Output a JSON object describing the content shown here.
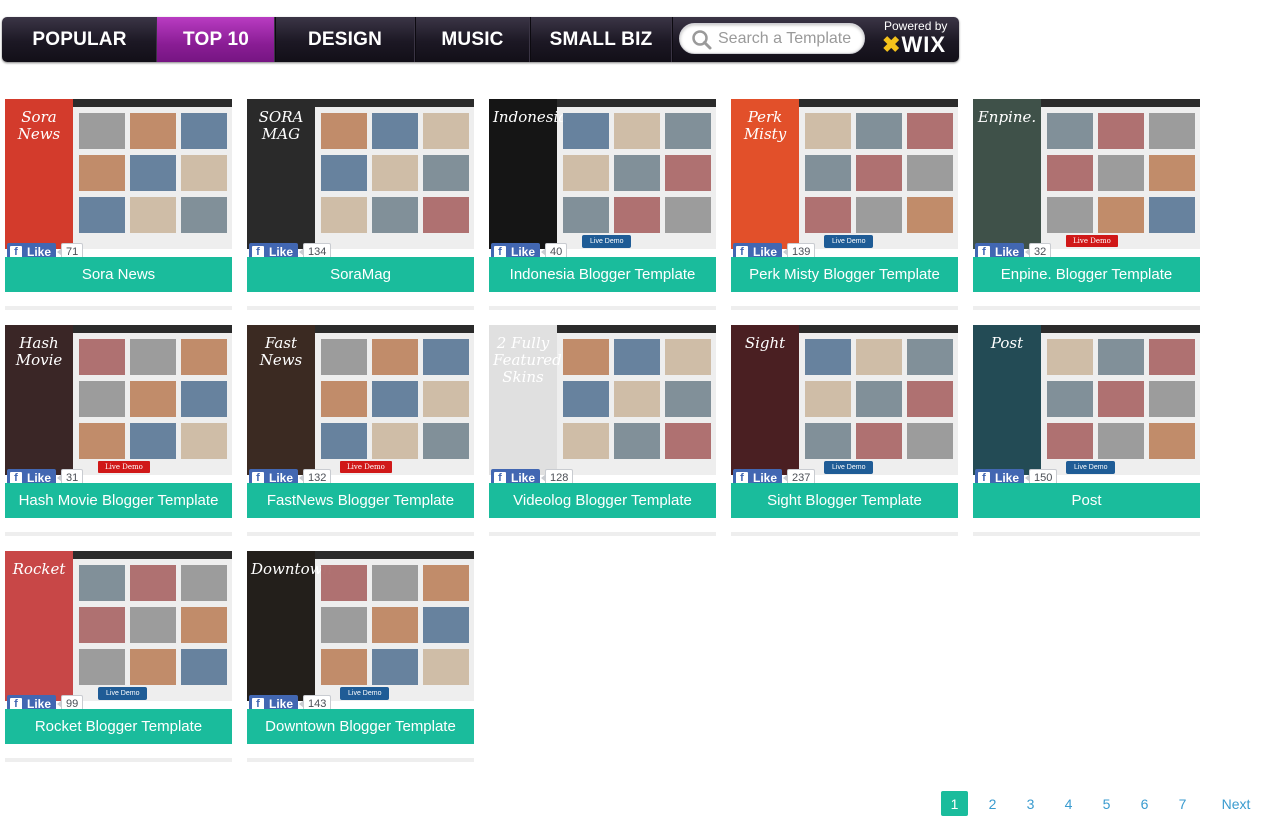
{
  "nav": {
    "tabs": [
      {
        "label": "POPULAR",
        "active": false
      },
      {
        "label": "TOP 10",
        "active": true
      },
      {
        "label": "DESIGN",
        "active": false
      },
      {
        "label": "MUSIC",
        "active": false
      },
      {
        "label": "SMALL BIZ",
        "active": false
      }
    ],
    "search_placeholder": "Search a Template",
    "powered_by": "Powered by",
    "brand": "WIX"
  },
  "colors": {
    "accent": "#1abc9c",
    "active_tab": "#8a1d95",
    "facebook": "#4267b2",
    "link": "#3a9bcf"
  },
  "cards": [
    {
      "title": "Sora News",
      "likes": "71",
      "thumb_label": "Sora News",
      "left_color": "#d33b2c",
      "demo": ""
    },
    {
      "title": "SoraMag",
      "likes": "134",
      "thumb_label": "SORA MAG",
      "left_color": "#2a2a2a",
      "demo": ""
    },
    {
      "title": "Indonesia Blogger Template",
      "likes": "40",
      "thumb_label": "Indonesia",
      "left_color": "#151515",
      "demo": "Live Demo",
      "demo_style": "blue"
    },
    {
      "title": "Perk Misty Blogger Template",
      "likes": "139",
      "thumb_label": "Perk Misty",
      "left_color": "#e2502a",
      "demo": "Live Demo",
      "demo_style": "blue"
    },
    {
      "title": "Enpine. Blogger Template",
      "likes": "32",
      "thumb_label": "Enpine.",
      "left_color": "#3f5149",
      "demo": "Live Demo",
      "demo_style": "red"
    },
    {
      "title": "Hash Movie Blogger Template",
      "likes": "31",
      "thumb_label": "Hash Movie",
      "left_color": "#3a2626",
      "demo": "Live Demo",
      "demo_style": "red"
    },
    {
      "title": "FastNews Blogger Template",
      "likes": "132",
      "thumb_label": "Fast News",
      "left_color": "#3b2a22",
      "demo": "Live Demo",
      "demo_style": "red"
    },
    {
      "title": "Videolog Blogger Template",
      "likes": "128",
      "thumb_label": "2 Fully Featured Skins",
      "left_color": "#e0e0e0",
      "demo": ""
    },
    {
      "title": "Sight Blogger Template",
      "likes": "237",
      "thumb_label": "Sight",
      "left_color": "#4a1f22",
      "demo": "Live Demo",
      "demo_style": "blue"
    },
    {
      "title": "Post",
      "likes": "150",
      "thumb_label": "Post",
      "left_color": "#234b55",
      "demo": "Live Demo",
      "demo_style": "blue"
    },
    {
      "title": "Rocket Blogger Template",
      "likes": "99",
      "thumb_label": "Rocket",
      "left_color": "#c84747",
      "demo": "Live Demo",
      "demo_style": "blue"
    },
    {
      "title": "Downtown Blogger Template",
      "likes": "143",
      "thumb_label": "Downtown",
      "left_color": "#231f1b",
      "demo": "Live Demo",
      "demo_style": "blue"
    }
  ],
  "like_label": "Like",
  "pagination": {
    "pages": [
      "1",
      "2",
      "3",
      "4",
      "5",
      "6",
      "7"
    ],
    "current": "1",
    "next_label": "Next"
  }
}
